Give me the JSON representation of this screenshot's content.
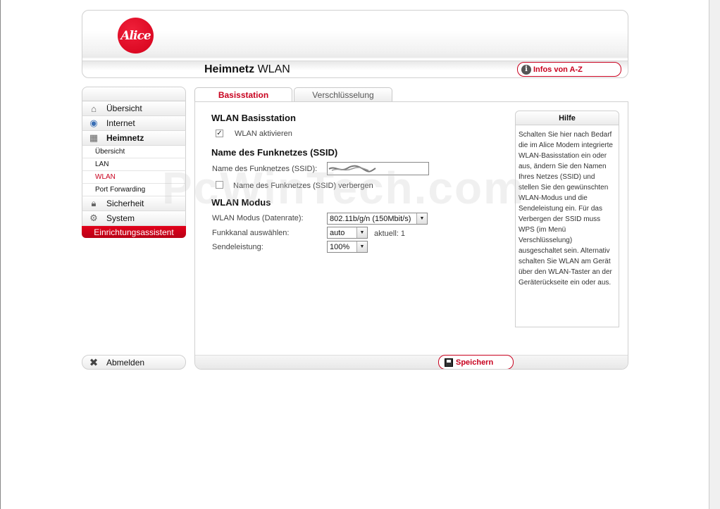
{
  "brand": {
    "logo_text": "Alice",
    "accent": "#c8001e"
  },
  "header": {
    "title_bold": "Heimnetz",
    "title_rest": "WLAN",
    "info_button": "Infos von A-Z"
  },
  "sidebar": {
    "items": [
      {
        "label": "Übersicht",
        "icon": "house-icon"
      },
      {
        "label": "Internet",
        "icon": "globe-icon"
      },
      {
        "label": "Heimnetz",
        "icon": "network-icon"
      }
    ],
    "sub_items": [
      "Übersicht",
      "LAN",
      "WLAN",
      "Port Forwarding"
    ],
    "items_after": [
      {
        "label": "Sicherheit",
        "icon": "lock-icon"
      },
      {
        "label": "System",
        "icon": "gear-icon"
      }
    ],
    "assistant": "Einrichtungsassistent",
    "logout": "Abmelden"
  },
  "tabs": {
    "basis": "Basisstation",
    "versch": "Verschlüsselung"
  },
  "form": {
    "section1": "WLAN Basisstation",
    "wlan_activate": "WLAN aktivieren",
    "section2": "Name des Funknetzes (SSID)",
    "ssid_label": "Name des Funknetzes (SSID):",
    "ssid_hide": "Name des Funknetzes (SSID) verbergen",
    "section3": "WLAN Modus",
    "mode_label": "WLAN Modus (Datenrate):",
    "mode_value": "802.11b/g/n (150Mbit/s)",
    "channel_label": "Funkkanal auswählen:",
    "channel_value": "auto",
    "channel_current": "aktuell: 1",
    "power_label": "Sendeleistung:",
    "power_value": "100%"
  },
  "help": {
    "title": "Hilfe",
    "text": "Schalten Sie hier nach Bedarf die im Alice Modem integrierte WLAN-Basisstation ein oder aus, ändern Sie den Namen Ihres Netzes (SSID) und stellen Sie den gewünschten WLAN-Modus und die Sendeleistung ein. Für das Verbergen der SSID muss WPS (im Menü Verschlüsselung) ausgeschaltet sein. Alternativ schalten Sie WLAN am Gerät über den WLAN-Taster an der Geräterückseite ein oder aus."
  },
  "save_button": "Speichern",
  "watermark": "PcWinTech.com"
}
